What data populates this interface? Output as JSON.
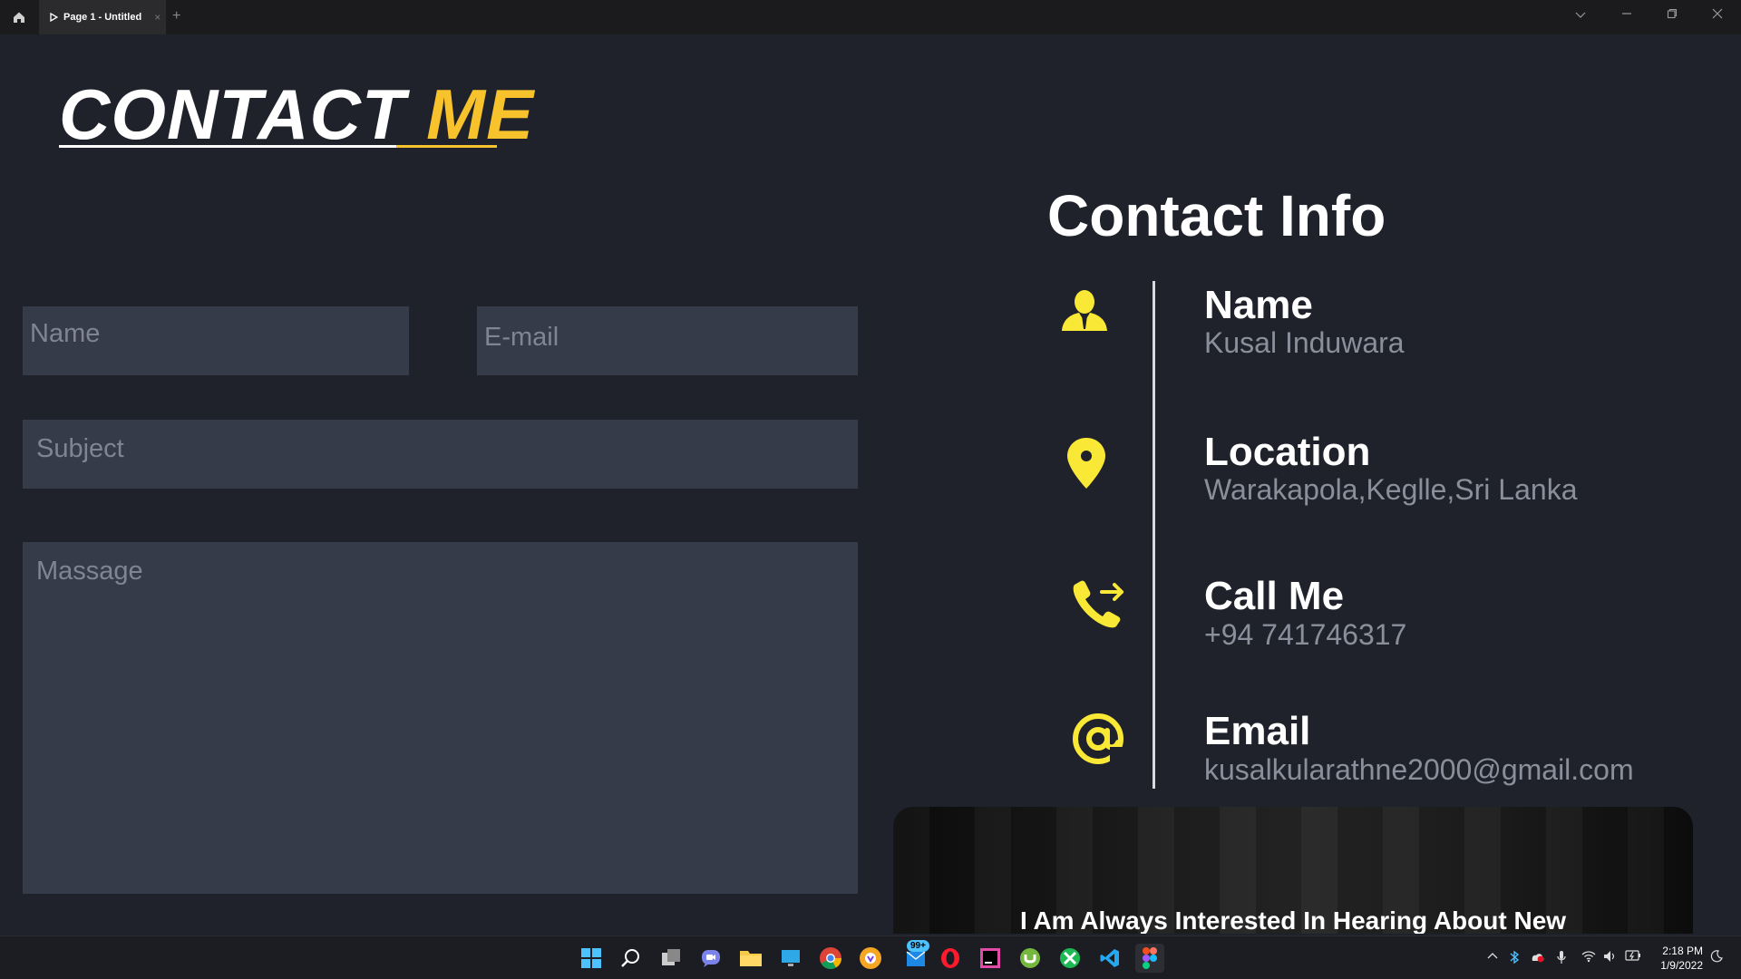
{
  "window": {
    "tab_title": "Page 1 - Untitled",
    "tab_close": "×",
    "tab_add": "+"
  },
  "left": {
    "title_part1": "CONTACT ",
    "title_part2": "ME",
    "fields": {
      "name_placeholder": "Name",
      "email_placeholder": "E-mail",
      "subject_placeholder": "Subject",
      "message_placeholder": "Massage"
    }
  },
  "right": {
    "title": "Contact Info",
    "items": [
      {
        "label": "Name",
        "value": "Kusal Induwara",
        "icon": "person-icon"
      },
      {
        "label": "Location",
        "value": "Warakapola,Keglle,Sri Lanka",
        "icon": "location-pin-icon"
      },
      {
        "label": "Call Me",
        "value": "+94 741746317",
        "icon": "phone-forward-icon"
      },
      {
        "label": "Email",
        "value": "kusalkularathne2000@gmail.com",
        "icon": "at-sign-icon"
      }
    ],
    "banner_text": "I Am Always Interested In Hearing About New"
  },
  "taskbar": {
    "notification_badge": "99+",
    "time": "2:18 PM",
    "date": "1/9/2022"
  },
  "colors": {
    "background": "#1f222a",
    "field": "#363b4a",
    "accent": "#f7c22c",
    "icon_yellow": "#f9e836"
  }
}
